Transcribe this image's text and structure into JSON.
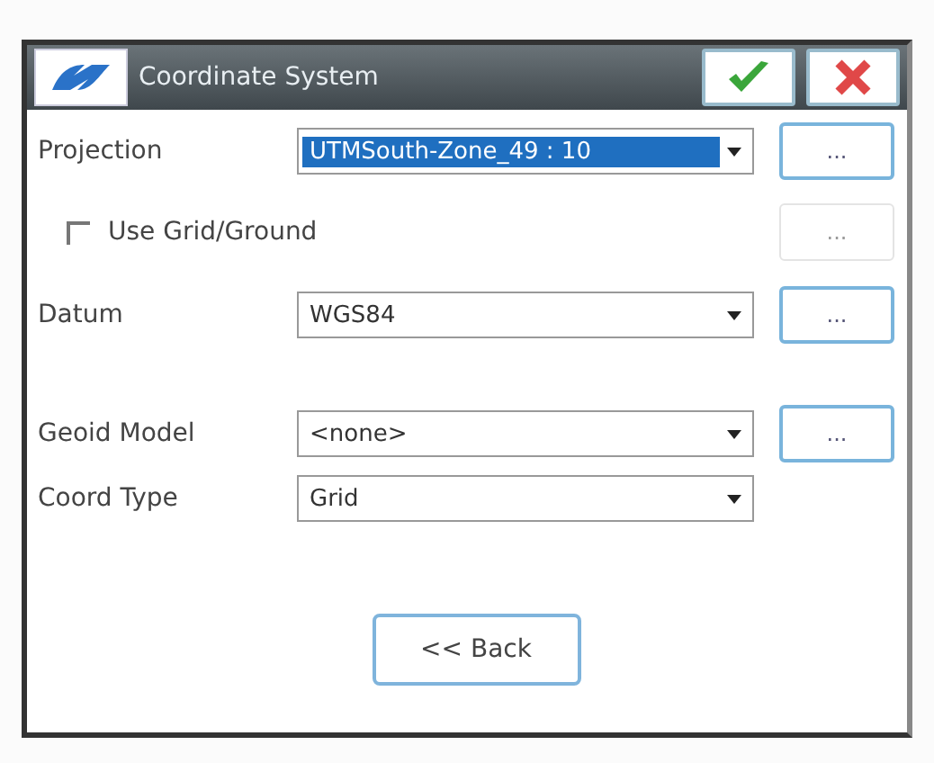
{
  "window": {
    "title": "Coordinate System"
  },
  "rows": [
    {
      "kind": "combo",
      "label": "Projection",
      "value": "UTMSouth-Zone_49 : 10",
      "highlighted": true,
      "more": "...",
      "more_disabled": false
    },
    {
      "kind": "checkbox",
      "label": "Use Grid/Ground",
      "checked": false,
      "more": "...",
      "more_disabled": true
    },
    {
      "kind": "combo",
      "label": "Datum",
      "value": "WGS84",
      "highlighted": false,
      "more": "...",
      "more_disabled": false
    },
    {
      "kind": "gap"
    },
    {
      "kind": "combo",
      "label": "Geoid Model",
      "value": "<none>",
      "highlighted": false,
      "more": "...",
      "more_disabled": false
    },
    {
      "kind": "combo",
      "label": "Coord Type",
      "value": "Grid",
      "highlighted": false
    }
  ],
  "back_button": "<< Back"
}
